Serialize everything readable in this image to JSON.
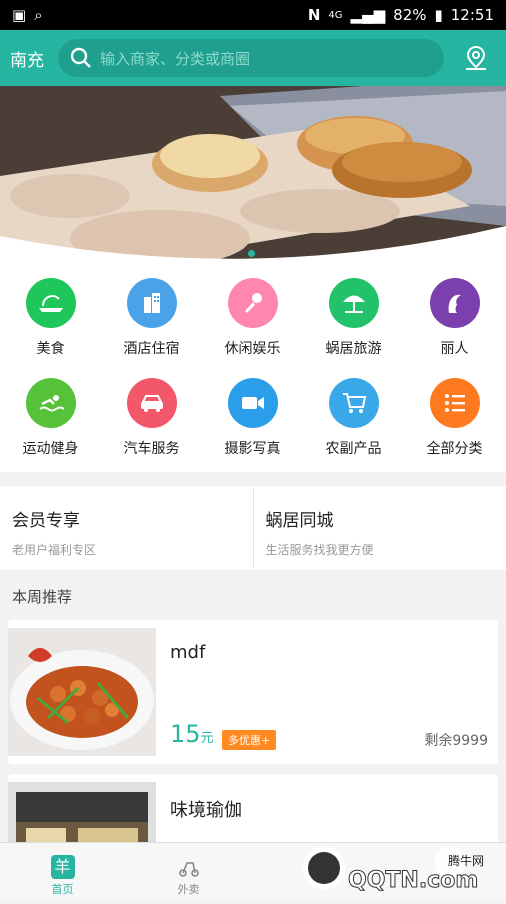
{
  "status": {
    "signal": "4G",
    "battery": "82%",
    "time": "12:51"
  },
  "header": {
    "city": "南充",
    "search_placeholder": "输入商家、分类或商圈"
  },
  "categories": [
    {
      "label": "美食",
      "color": "#1fc65a",
      "icon": "food-icon"
    },
    {
      "label": "酒店住宿",
      "color": "#4aa3e8",
      "icon": "hotel-icon"
    },
    {
      "label": "休闲娱乐",
      "color": "#ff86b0",
      "icon": "microphone-icon"
    },
    {
      "label": "蜗居旅游",
      "color": "#22c26b",
      "icon": "umbrella-icon"
    },
    {
      "label": "丽人",
      "color": "#7b3fae",
      "icon": "beauty-icon"
    },
    {
      "label": "运动健身",
      "color": "#55c23a",
      "icon": "swim-icon"
    },
    {
      "label": "汽车服务",
      "color": "#f2576a",
      "icon": "car-icon"
    },
    {
      "label": "摄影写真",
      "color": "#2a9ee8",
      "icon": "camera-icon"
    },
    {
      "label": "农副产品",
      "color": "#3aa8e8",
      "icon": "cart-icon"
    },
    {
      "label": "全部分类",
      "color": "#ff7a1f",
      "icon": "list-icon"
    }
  ],
  "promos": [
    {
      "title": "会员专享",
      "subtitle": "老用户福利专区"
    },
    {
      "title": "蜗居同城",
      "subtitle": "生活服务找我更方便"
    }
  ],
  "week_title": "本周推荐",
  "listings": [
    {
      "name": "mdf",
      "price": "15",
      "unit": "元",
      "tag": "多优惠+",
      "remain": "剩余9999"
    },
    {
      "name": "味境瑜伽"
    }
  ],
  "tabs": [
    {
      "label": "首页"
    },
    {
      "label": "外卖"
    }
  ],
  "watermark": {
    "brand": "腾牛网",
    "domain": "QQTN.com"
  }
}
